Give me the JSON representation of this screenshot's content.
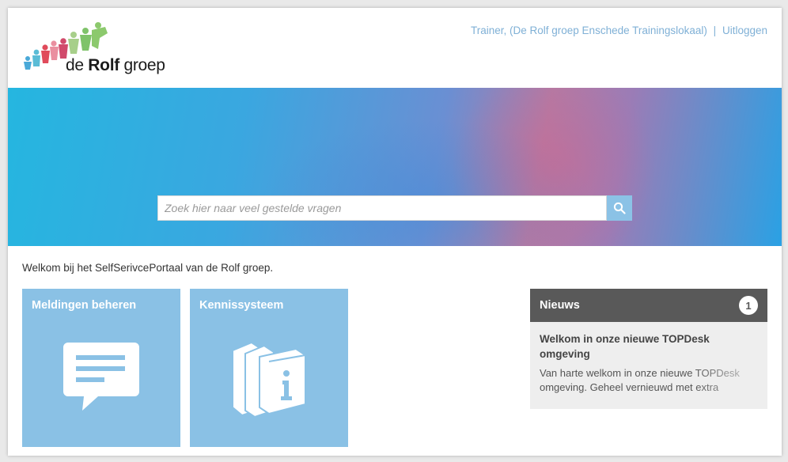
{
  "header": {
    "logo_prefix": "de ",
    "logo_brand": "Rolf",
    "logo_suffix": " groep",
    "user_label": "Trainer, (De Rolf groep Enschede Trainingslokaal)",
    "separator": "|",
    "logout_label": "Uitloggen"
  },
  "search": {
    "placeholder": "Zoek hier naar veel gestelde vragen",
    "button_icon": "search-icon"
  },
  "welcome_text": "Welkom bij het SelfSerivcePortaal van de Rolf groep.",
  "tiles": [
    {
      "title": "Meldingen beheren",
      "icon": "chat-bubble-icon"
    },
    {
      "title": "Kennissysteem",
      "icon": "books-info-icon"
    }
  ],
  "news": {
    "title": "Nieuws",
    "count": "1",
    "item_title": "Welkom in onze nieuwe TOPDesk omgeving",
    "item_text": "Van harte welkom in onze nieuwe TOPDesk omgeving. Geheel vernieuwd met extra"
  },
  "colors": {
    "tile": "#8ac1e5",
    "link": "#7fb0d6",
    "news_header": "#595959"
  }
}
